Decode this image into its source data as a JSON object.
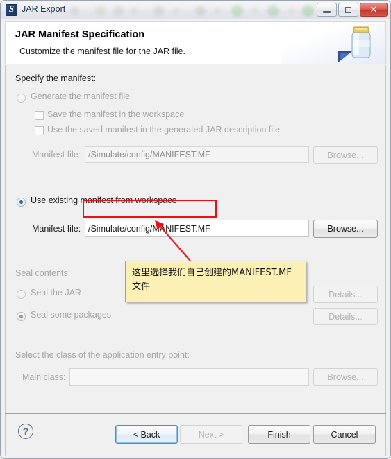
{
  "window": {
    "title": "JAR Export",
    "app_icon": "jar-export-icon",
    "controls": {
      "minimize": "minimize-icon",
      "maximize": "restore-icon",
      "close": "✕"
    }
  },
  "header": {
    "title": "JAR Manifest Specification",
    "subtitle": "Customize the manifest file for the JAR file.",
    "icon": "jar-jar-icon"
  },
  "content": {
    "specify_label": "Specify the manifest:",
    "generate_radio": {
      "label": "Generate the manifest file",
      "selected": false,
      "enabled": false
    },
    "checkboxes": [
      {
        "label": "Save the manifest in the workspace",
        "checked": false,
        "enabled": false
      },
      {
        "label": "Use the saved manifest in the generated JAR description file",
        "checked": false,
        "enabled": false
      }
    ],
    "manifest_disabled_row": {
      "label": "Manifest file:",
      "value": "/Simulate/config/MANIFEST.MF",
      "browse_label": "Browse...",
      "enabled": false
    },
    "use_existing_radio": {
      "label": "Use existing manifest from workspace",
      "selected": true,
      "enabled": true
    },
    "manifest_active_row": {
      "label": "Manifest file:",
      "value": "/Simulate/config/MANIFEST.MF",
      "browse_label": "Browse...",
      "enabled": true
    },
    "seal": {
      "section_label": "Seal contents:",
      "options": [
        {
          "label": "Seal the JAR",
          "selected": false,
          "details_label": "Details..."
        },
        {
          "label": "Seal some packages",
          "selected": true,
          "details_label": "Details..."
        }
      ],
      "enabled": false
    },
    "entry_point": {
      "section_label": "Select the class of the application entry point:",
      "main_class_label": "Main class:",
      "main_class_value": "",
      "browse_label": "Browse...",
      "enabled": false
    }
  },
  "footer": {
    "help_icon": "?",
    "buttons": [
      {
        "label": "< Back",
        "enabled": true,
        "focused": true
      },
      {
        "label": "Next >",
        "enabled": false,
        "focused": false
      },
      {
        "label": "Finish",
        "enabled": true,
        "focused": false
      },
      {
        "label": "Cancel",
        "enabled": true,
        "focused": false
      }
    ]
  },
  "annotation": {
    "callout_line1": "这里选择我们自己创建的MANIFEST.MF",
    "callout_line2": "文件",
    "highlight_color": "#e81010",
    "callout_bg": "#fdf0b4",
    "callout_border": "#c9a227"
  }
}
